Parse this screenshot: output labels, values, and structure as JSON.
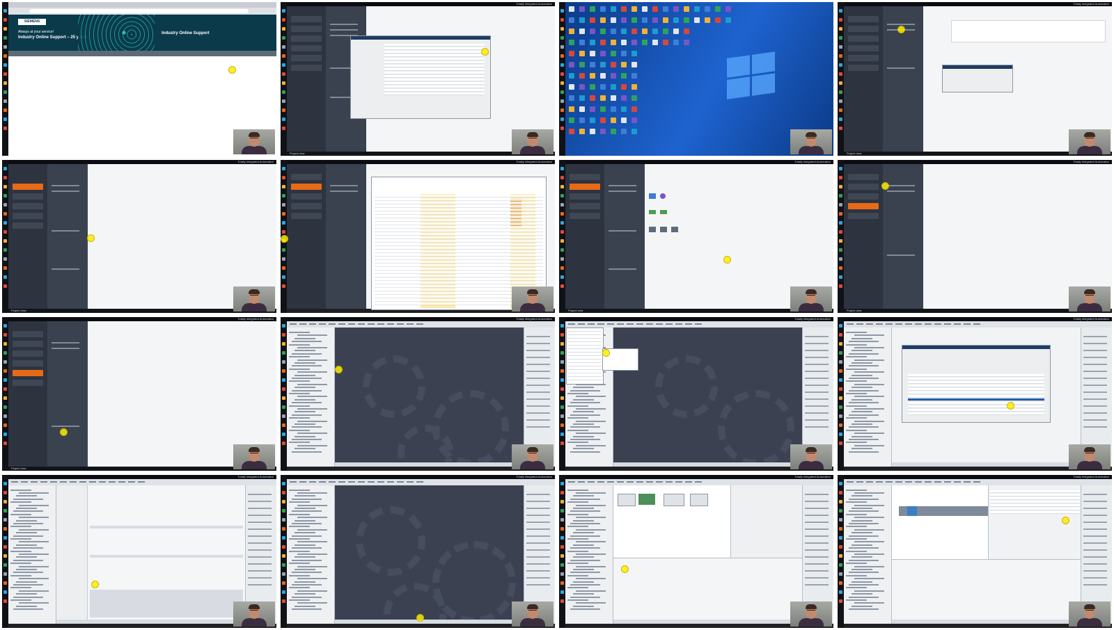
{
  "app": {
    "title_right": "Totally Integrated Automation",
    "portal_footer": "Project view",
    "browser_hero_small": "Always at your service!",
    "browser_hero_big": "Industry Online Support – 25 years",
    "browser_hero_right": "Industry Online Support",
    "browser_logo": "SIEMENS"
  },
  "colors": {
    "tia_dark": "#2d3440",
    "tia_orange": "#e86a17",
    "work_area": "#3b4151",
    "cursor": "#ffeb00",
    "desktop_blue": "#1e63d0"
  },
  "thumbnails": [
    {
      "id": "t1",
      "kind": "browser"
    },
    {
      "id": "t2",
      "kind": "portal-dialog"
    },
    {
      "id": "t3",
      "kind": "desktop"
    },
    {
      "id": "t4",
      "kind": "portal-dialog-small"
    },
    {
      "id": "t5",
      "kind": "portal"
    },
    {
      "id": "t6",
      "kind": "portal-table"
    },
    {
      "id": "t7",
      "kind": "portal-devices"
    },
    {
      "id": "t8",
      "kind": "portal"
    },
    {
      "id": "t9",
      "kind": "portal"
    },
    {
      "id": "t10",
      "kind": "project"
    },
    {
      "id": "t11",
      "kind": "project-menu"
    },
    {
      "id": "t12",
      "kind": "project-dialog"
    },
    {
      "id": "t13",
      "kind": "project-settings"
    },
    {
      "id": "t14",
      "kind": "project"
    },
    {
      "id": "t15",
      "kind": "project-network"
    },
    {
      "id": "t16",
      "kind": "project-hw"
    }
  ]
}
